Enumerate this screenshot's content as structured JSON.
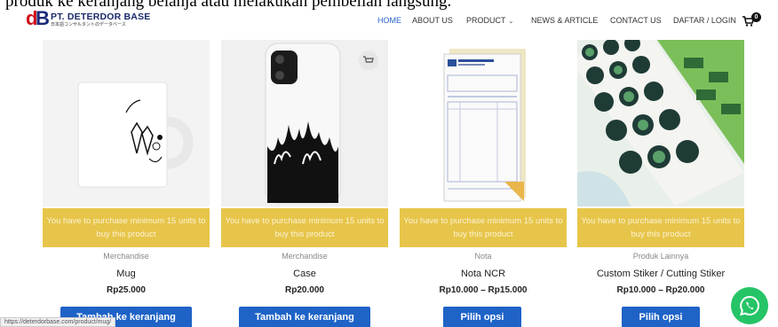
{
  "caption": "produk ke keranjang belanja atau melakukan pembelian langsung.",
  "header": {
    "logo_letters": "dB",
    "logo_name": "PT. DETERDOR BASE",
    "logo_tagline": "日本語コンサルタントのデータベース",
    "nav": [
      {
        "label": "HOME",
        "active": true
      },
      {
        "label": "ABOUT US",
        "active": false
      },
      {
        "label": "PRODUCT",
        "active": false
      },
      {
        "label": "NEWS & ARTICLE",
        "active": false
      },
      {
        "label": "CONTACT US",
        "active": false
      },
      {
        "label": "DAFTAR / LOGIN",
        "active": false
      }
    ],
    "cart_count": "0",
    "accent_color": "#2a63c9"
  },
  "products": [
    {
      "notice": "You have to purchase minimum 15 units to buy this product",
      "category": "Merchandise",
      "name": "Mug",
      "price": "Rp25.000",
      "button": "Tambah ke keranjang"
    },
    {
      "notice": "You have to purchase minimum 15 units to buy this product",
      "category": "Merchandise",
      "name": "Case",
      "price": "Rp20.000",
      "button": "Tambah ke keranjang"
    },
    {
      "notice": "You have to purchase minimum 15 units to buy this product",
      "category": "Nota",
      "name": "Nota NCR",
      "price": "Rp10.000 – Rp15.000",
      "button": "Pilih opsi"
    },
    {
      "notice": "You have to purchase minimum 15 units to buy this product",
      "category": "Produk Lainnya",
      "name": "Custom Stiker / Cutting Stiker",
      "price": "Rp10.000 – Rp20.000",
      "button": "Pilih opsi"
    }
  ],
  "colors": {
    "notice_bg": "#e7c54a",
    "button_bg": "#1f63c7",
    "whatsapp": "#25c466"
  },
  "status_url": "https://deterdorbase.com/product/mug/",
  "icons": [
    "cart-icon",
    "chevron-down-icon",
    "wishlist-cart-icon",
    "whatsapp-icon"
  ]
}
